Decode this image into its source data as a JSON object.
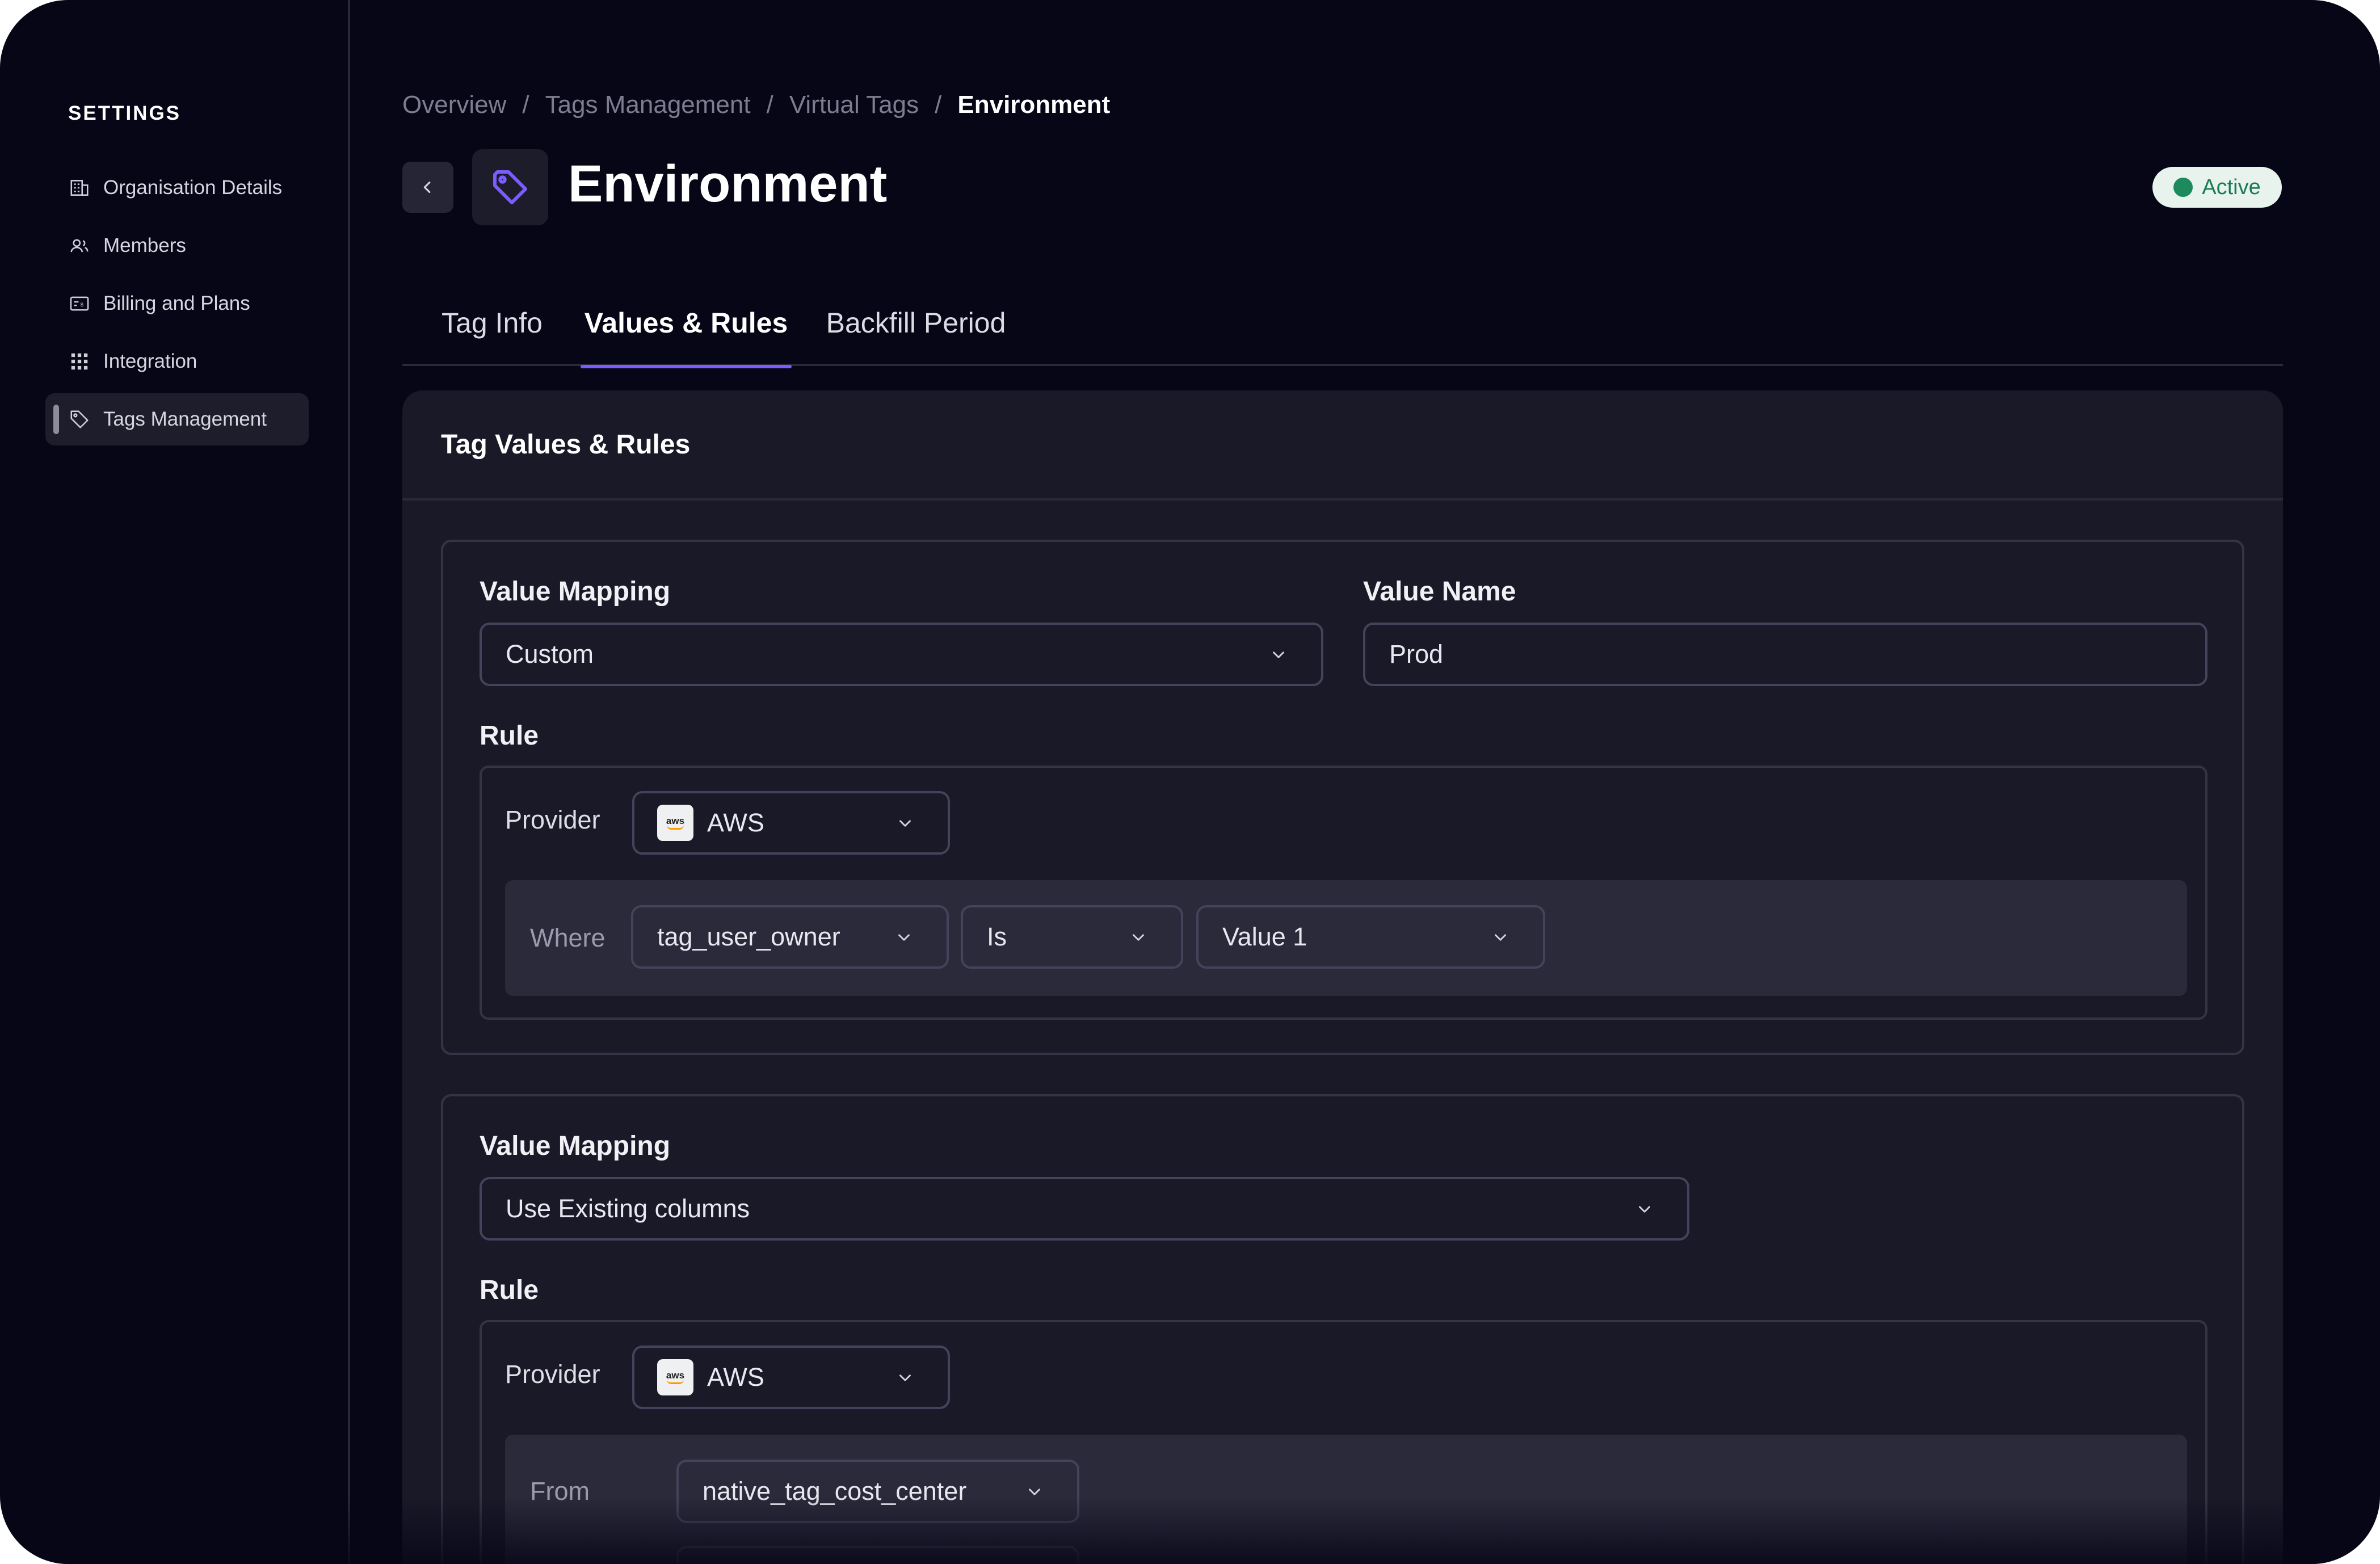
{
  "sidebar": {
    "title": "SETTINGS",
    "items": [
      {
        "label": "Organisation Details",
        "icon": "building-icon"
      },
      {
        "label": "Members",
        "icon": "users-icon"
      },
      {
        "label": "Billing and Plans",
        "icon": "billing-icon"
      },
      {
        "label": "Integration",
        "icon": "grid-icon"
      },
      {
        "label": "Tags Management",
        "icon": "tag-icon",
        "active": true
      }
    ]
  },
  "breadcrumb": {
    "items": [
      "Overview",
      "Tags Management",
      "Virtual Tags"
    ],
    "current": "Environment",
    "separator": "/"
  },
  "header": {
    "title": "Environment",
    "back_icon": "chevron-left-icon",
    "tag_icon": "tag-icon",
    "status": "Active",
    "status_color": "#1d8a5d"
  },
  "tabs": [
    {
      "label": "Tag Info"
    },
    {
      "label": "Values & Rules",
      "active": true
    },
    {
      "label": "Backfill Period"
    }
  ],
  "accent_color": "#7c5cff",
  "card": {
    "title": "Tag Values & Rules",
    "rule1": {
      "value_mapping_label": "Value Mapping",
      "value_mapping_value": "Custom",
      "value_name_label": "Value Name",
      "value_name_value": "Prod",
      "rule_label": "Rule",
      "provider_label": "Provider",
      "provider_value": "AWS",
      "provider_logo_text": "aws",
      "where_label": "Where",
      "field_value": "tag_user_owner",
      "operator_value": "Is",
      "value_value": "Value 1"
    },
    "rule2": {
      "value_mapping_label": "Value Mapping",
      "value_mapping_value": "Use Existing columns",
      "rule_label": "Rule",
      "provider_label": "Provider",
      "provider_value": "AWS",
      "provider_logo_text": "aws",
      "from_label": "From",
      "from_value": "native_tag_cost_center"
    }
  }
}
